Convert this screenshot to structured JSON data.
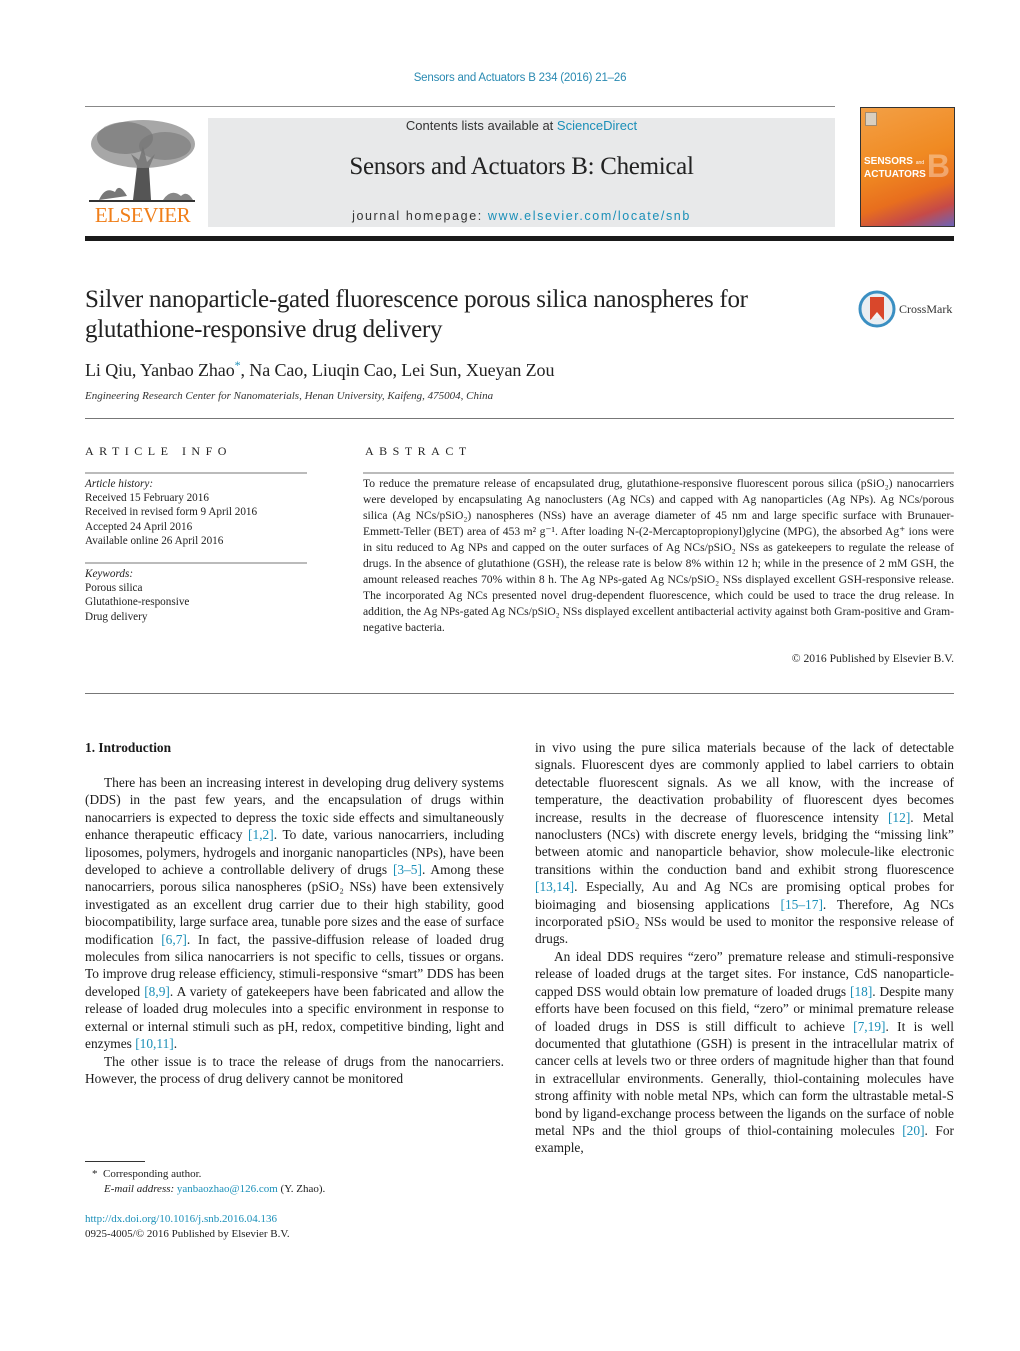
{
  "header": {
    "citation": "Sensors and Actuators B 234 (2016) 21–26",
    "contents_prefix": "Contents lists available at ",
    "contents_link": "ScienceDirect",
    "journal_title": "Sensors and Actuators B: Chemical",
    "homepage_prefix": "journal homepage: ",
    "homepage_link": "www.elsevier.com/locate/snb",
    "publisher_logo_text": "ELSEVIER",
    "cover": {
      "line1": "SENSORS",
      "and": "and",
      "line2": "ACTUATORS",
      "letter": "B"
    },
    "colors": {
      "link": "#1a8fb8",
      "elsevier_orange": "#f07f1a",
      "banner_bg": "#e8e9ea"
    }
  },
  "article": {
    "title": "Silver nanoparticle-gated fluorescence porous silica nanospheres for glutathione-responsive drug delivery",
    "crossmark_label": "CrossMark",
    "authors_before": "Li Qiu, Yanbao Zhao",
    "author_mark": "*",
    "authors_after": ", Na Cao, Liuqin Cao, Lei Sun, Xueyan Zou",
    "affiliation": "Engineering Research Center for Nanomaterials, Henan University, Kaifeng, 475004, China"
  },
  "article_info": {
    "heading": "ARTICLE INFO",
    "history_label": "Article history:",
    "history": [
      "Received 15 February 2016",
      "Received in revised form 9 April 2016",
      "Accepted 24 April 2016",
      "Available online 26 April 2016"
    ],
    "keywords_label": "Keywords:",
    "keywords": [
      "Porous silica",
      "Glutathione-responsive",
      "Drug delivery"
    ]
  },
  "abstract": {
    "heading": "ABSTRACT",
    "text": "To reduce the premature release of encapsulated drug, glutathione-responsive fluorescent porous silica (pSiO₂) nanocarriers were developed by encapsulating Ag nanoclusters (Ag NCs) and capped with Ag nanoparticles (Ag NPs). Ag NCs/porous silica (Ag NCs/pSiO₂) nanospheres (NSs) have an average diameter of 45 nm and large specific surface with Brunauer-Emmett-Teller (BET) area of 453 m² g⁻¹. After loading N-(2-Mercaptopropionyl)glycine (MPG), the absorbed Ag⁺ ions were in situ reduced to Ag NPs and capped on the outer surfaces of Ag NCs/pSiO₂ NSs as gatekeepers to regulate the release of drugs. In the absence of glutathione (GSH), the release rate is below 8% within 12 h; while in the presence of 2 mM GSH, the amount released reaches 70% within 8 h. The Ag NPs-gated Ag NCs/pSiO₂ NSs displayed excellent GSH-responsive release. The incorporated Ag NCs presented novel drug-dependent fluorescence, which could be used to trace the drug release. In addition, the Ag NPs-gated Ag NCs/pSiO₂ NSs displayed excellent antibacterial activity against both Gram-positive and Gram-negative bacteria.",
    "copyright": "© 2016 Published by Elsevier B.V."
  },
  "body": {
    "section_heading": "1.  Introduction",
    "left_paragraphs": [
      [
        {
          "t": "There has been an increasing interest in developing drug delivery systems (DDS) in the past few years, and the encapsulation of drugs within nanocarriers is expected to depress the toxic side effects and simultaneously enhance therapeutic efficacy "
        },
        {
          "ref": "[1,2]"
        },
        {
          "t": ". To date, various nanocarriers, including liposomes, polymers, hydrogels and inorganic nanoparticles (NPs), have been developed to achieve a controllable delivery of drugs "
        },
        {
          "ref": "[3–5]"
        },
        {
          "t": ". Among these nanocarriers, porous silica nanospheres (pSiO₂ NSs) have been extensively investigated as an excellent drug carrier due to their high stability, good biocompatibility, large surface area, tunable pore sizes and the ease of surface modification "
        },
        {
          "ref": "[6,7]"
        },
        {
          "t": ". In fact, the passive-diffusion release of loaded drug molecules from silica nanocarriers is not specific to cells, tissues or organs. To improve drug release efficiency, stimuli-responsive “smart” DDS has been developed "
        },
        {
          "ref": "[8,9]"
        },
        {
          "t": ". A variety of gatekeepers have been fabricated and allow the release of loaded drug molecules into a specific environment in response to external or internal stimuli such as pH, redox, competitive binding, light and enzymes "
        },
        {
          "ref": "[10,11]"
        },
        {
          "t": "."
        }
      ],
      [
        {
          "t": "The other issue is to trace the release of drugs from the nanocarriers. However, the process of drug delivery cannot be monitored"
        }
      ]
    ],
    "right_paragraphs": [
      [
        {
          "t": "in vivo using the pure silica materials because of the lack of detectable signals. Fluorescent dyes are commonly applied to label carriers to obtain detectable fluorescent signals. As we all know, with the increase of temperature, the deactivation probability of fluorescent dyes becomes increase, results in the decrease of fluorescence intensity "
        },
        {
          "ref": "[12]"
        },
        {
          "t": ". Metal nanoclusters (NCs) with discrete energy levels, bridging the “missing link” between atomic and nanoparticle behavior, show molecule-like electronic transitions within the conduction band and exhibit strong fluorescence "
        },
        {
          "ref": "[13,14]"
        },
        {
          "t": ". Especially, Au and Ag NCs are promising optical probes for bioimaging and biosensing applications "
        },
        {
          "ref": "[15–17]"
        },
        {
          "t": ". Therefore, Ag NCs incorporated pSiO₂ NSs would be used to monitor the responsive release of drugs."
        }
      ],
      [
        {
          "t": "An ideal DDS requires “zero” premature release and stimuli-responsive release of loaded drugs at the target sites. For instance, CdS nanoparticle-capped DSS would obtain low premature of loaded drugs "
        },
        {
          "ref": "[18]"
        },
        {
          "t": ". Despite many efforts have been focused on this field, “zero” or minimal premature release of loaded drugs in DSS is still difficult to achieve "
        },
        {
          "ref": "[7,19]"
        },
        {
          "t": ". It is well documented that glutathione (GSH) is present in the intracellular matrix of cancer cells at levels two or three orders of magnitude higher than that found in extracellular environments. Generally, thiol-containing molecules have strong affinity with noble metal NPs, which can form the ultrastable metal-S bond by ligand-exchange process between the ligands on the surface of noble metal NPs and the thiol groups of thiol-containing molecules "
        },
        {
          "ref": "[20]"
        },
        {
          "t": ". For example,"
        }
      ]
    ]
  },
  "footnotes": {
    "mark": "*",
    "corresponding": "Corresponding author.",
    "email_label": "E-mail address:",
    "email": "yanbaozhao@126.com",
    "email_suffix": " (Y. Zhao).",
    "doi": "http://dx.doi.org/10.1016/j.snb.2016.04.136",
    "issn_line": "0925-4005/© 2016 Published by Elsevier B.V."
  }
}
